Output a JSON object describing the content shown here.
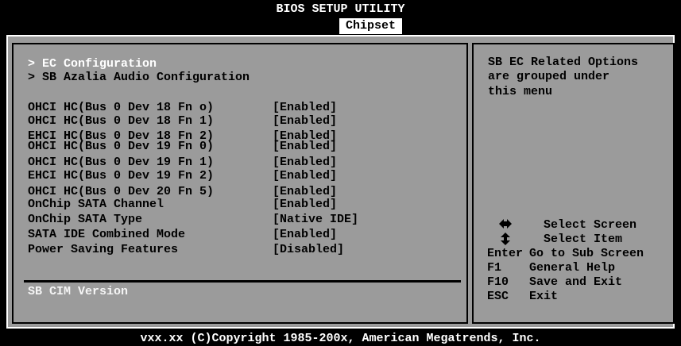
{
  "header": {
    "title": "BIOS SETUP UTILITY",
    "active_tab": "Chipset"
  },
  "main": {
    "submenus": [
      "> EC Configuration",
      "> SB Azalia Audio Configuration"
    ],
    "settings": [
      {
        "label": "OHCI HC(Bus 0 Dev 18 Fn o)",
        "value": "[Enabled]"
      },
      {
        "label": "OHCI HC(Bus 0 Dev 18 Fn 1)",
        "value": "[Enabled]"
      },
      {
        "label": "EHCI HC(Bus 0 Dev 18 Fn 2)",
        "value": "[Enabled]"
      },
      {
        "label": "OHCI HC(Bus 0 Dev 19 Fn 0)",
        "value": "[Enabled]"
      },
      {
        "label": "OHCI HC(Bus 0 Dev 19 Fn 1)",
        "value": "[Enabled]"
      },
      {
        "label": "EHCI HC(Bus 0 Dev 19 Fn 2)",
        "value": "[Enabled]"
      },
      {
        "label": "OHCI HC(Bus 0 Dev 20 Fn 5)",
        "value": "[Enabled]"
      },
      {
        "label": "OnChip SATA Channel",
        "value": "[Enabled]"
      },
      {
        "label": "OnChip SATA Type",
        "value": "[Native IDE]"
      },
      {
        "label": "SATA IDE Combined Mode",
        "value": "[Enabled]"
      },
      {
        "label": "Power Saving Features",
        "value": "[Disabled]"
      }
    ],
    "info": "SB CIM Version"
  },
  "help": {
    "text": [
      "SB EC Related Options",
      "are grouped under",
      "this menu"
    ],
    "keys": [
      {
        "key": "",
        "desc": "Select Screen",
        "icon": "left-right-arrows-icon"
      },
      {
        "key": "",
        "desc": "Select Item",
        "icon": "up-down-arrows-icon"
      },
      {
        "key": "Enter",
        "desc": "Go to Sub Screen"
      },
      {
        "key": "F1",
        "desc": "General Help"
      },
      {
        "key": "F10",
        "desc": "Save and Exit"
      },
      {
        "key": "ESC",
        "desc": "Exit"
      }
    ]
  },
  "footer": {
    "copyright": "vxx.xx (C)Copyright 1985-200x, American Megatrends, Inc."
  }
}
